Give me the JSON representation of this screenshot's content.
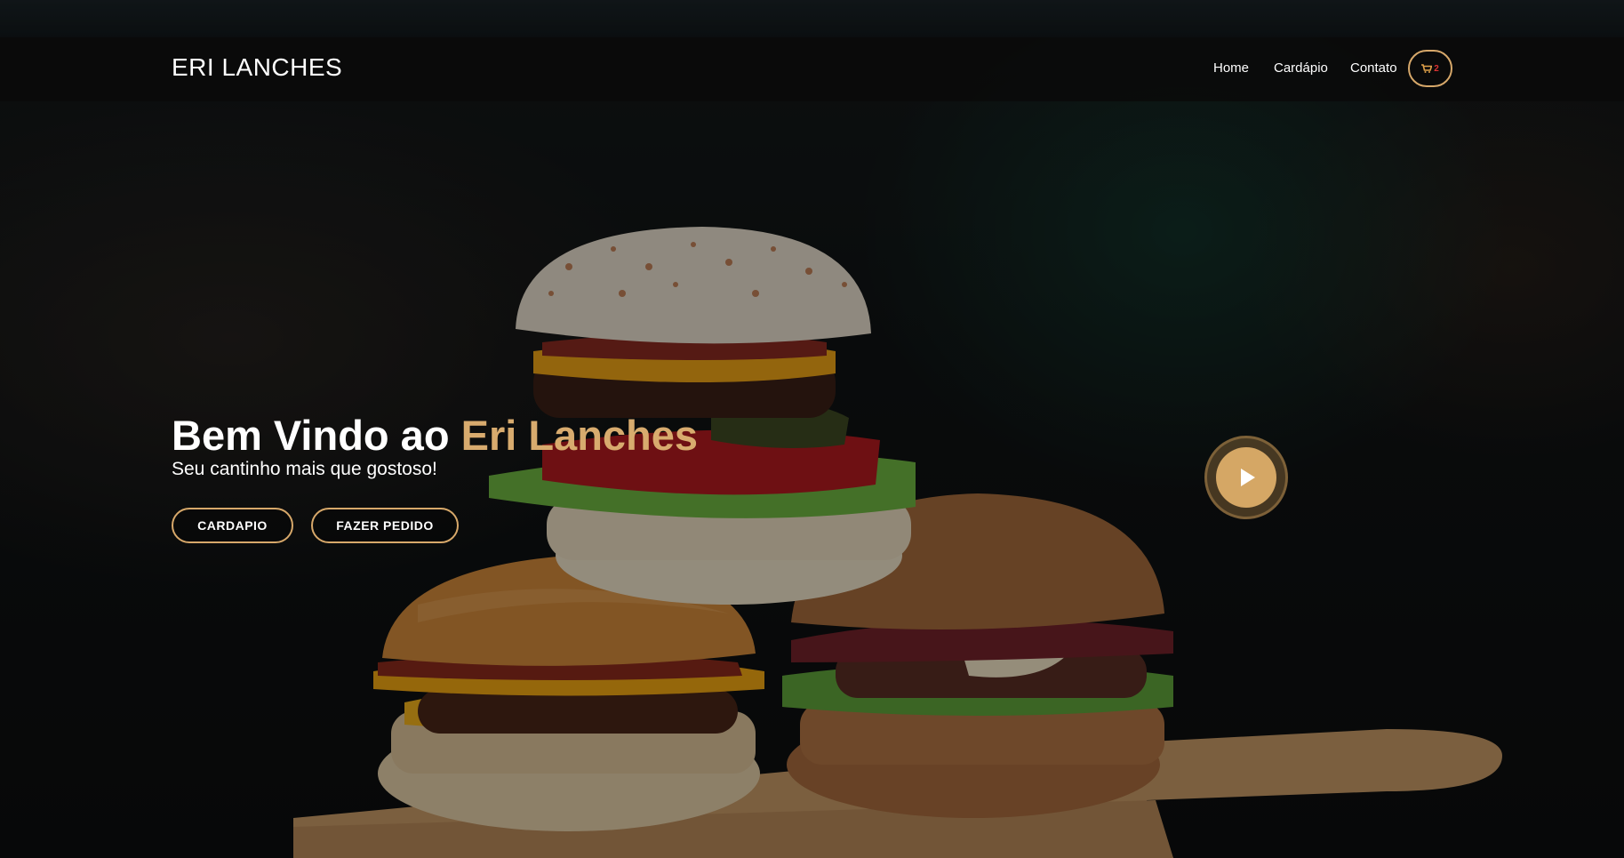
{
  "brand": {
    "name": "ERI LANCHES"
  },
  "nav": {
    "items": [
      {
        "label": "Home"
      },
      {
        "label": "Cardápio"
      },
      {
        "label": "Contato"
      }
    ],
    "cart": {
      "count": "2",
      "icon": "cart-icon"
    }
  },
  "hero": {
    "title_prefix": "Bem Vindo ao ",
    "title_accent": "Eri Lanches",
    "subtitle": "Seu cantinho mais que gostoso!",
    "buttons": [
      {
        "label": "CARDAPIO"
      },
      {
        "label": "FAZER PEDIDO"
      }
    ],
    "play_icon": "play-icon"
  },
  "colors": {
    "accent": "#d7a86a",
    "navbar": "#0a0a0a",
    "cart_count": "#dd3333"
  }
}
